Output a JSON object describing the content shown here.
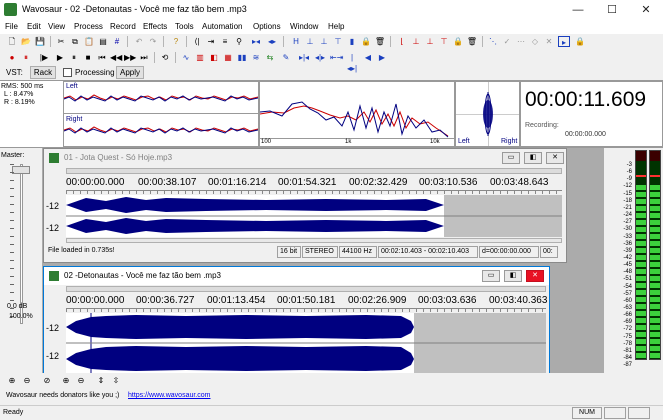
{
  "window": {
    "title": "Wavosaur - 02 -Detonautas - Você me faz tão bem .mp3",
    "minimize": "—",
    "maximize": "☐",
    "close": "✕"
  },
  "menu": [
    "File",
    "Edit",
    "View",
    "Process",
    "Record",
    "Effects",
    "Tools",
    "Automation",
    "Options",
    "Window",
    "Help"
  ],
  "vst": {
    "label": "VST:",
    "rack": "Rack",
    "processing": "Processing",
    "apply": "Apply"
  },
  "meter": {
    "rms": "RMS: 500 ms",
    "left_val": "L : 8.47%",
    "right_val": "R : 8.19%",
    "left_label": "Left",
    "right_label": "Right",
    "spec_100": "100",
    "spec_1k": "1k",
    "spec_10k": "10k",
    "phase_left": "Left",
    "phase_right": "Right",
    "time": "00:00:11.609",
    "recording_label": "Recording:",
    "recording_time": "00:00:00.000"
  },
  "master": {
    "label": "Master:",
    "db": "0.0 dB",
    "pct": "100.0%"
  },
  "win1": {
    "title": "01 - Jota Quest - Só Hoje.mp3",
    "times": [
      "00:00:00.000",
      "00:00:38.107",
      "00:01:16.214",
      "00:01:54.321",
      "00:02:32.429",
      "00:03:10.536",
      "00:03:48.643"
    ],
    "scale_top": "-12",
    "scale_bot": "-12",
    "status_msg": "File loaded in 0.735s!",
    "bits": "16 bit",
    "stereo": "STEREO",
    "rate": "44100 Hz",
    "range": "00:02:10.403 - 00:02:10.403",
    "dur": "d=00:00:00.000",
    "extra": "00:"
  },
  "win2": {
    "title": "02 -Detonautas - Você me faz tão bem .mp3",
    "times": [
      "00:00:00.000",
      "00:00:36.727",
      "00:01:13.454",
      "00:01:50.181",
      "00:02:26.909",
      "00:03:03.636",
      "00:03:40.363"
    ],
    "scale_top": "-12",
    "scale_bot": "-12"
  },
  "vu_scale": [
    "-3",
    "-6",
    "-9",
    "-12",
    "-15",
    "-18",
    "-21",
    "-24",
    "-27",
    "-30",
    "-33",
    "-36",
    "-39",
    "-42",
    "-45",
    "-48",
    "-51",
    "-54",
    "-57",
    "-60",
    "-63",
    "-66",
    "-69",
    "-72",
    "-75",
    "-78",
    "-81",
    "-84",
    "-87"
  ],
  "donators": {
    "text": "Wavosaur needs donators like you ;)",
    "link": "https://www.wavosaur.com"
  },
  "status": {
    "ready": "Ready",
    "num": "NUM"
  },
  "colors": {
    "wave": "#000080",
    "accent": "#0078d7",
    "spectrum_red": "#cc0000"
  }
}
